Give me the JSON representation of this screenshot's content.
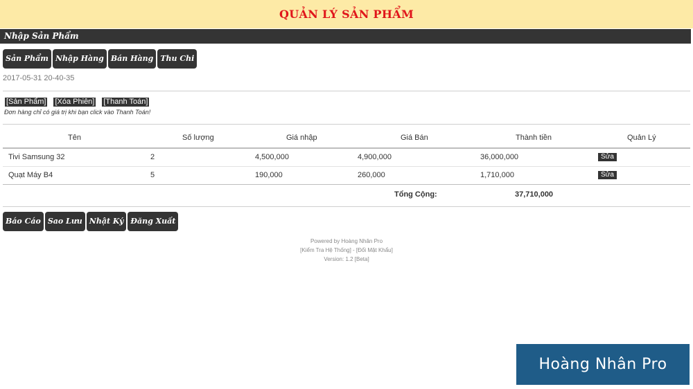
{
  "header": {
    "title": "QUẢN LÝ SẢN PHẨM"
  },
  "section": {
    "title": "Nhập Sản Phẩm"
  },
  "nav_top": [
    "Sản Phẩm",
    "Nhập Hàng",
    "Bán Hàng",
    "Thu Chi"
  ],
  "timestamp": "2017-05-31 20-40-35",
  "session_links": [
    "[Sản Phẩm]",
    "[Xóa Phiên]",
    "[Thanh Toán]"
  ],
  "note": "Đơn hàng chỉ có giá trị khi bạn click vào Thanh Toán!",
  "table": {
    "columns": [
      "Tên",
      "Số lượng",
      "Giá nhập",
      "Giá Bán",
      "Thành tiền",
      "Quản Lý"
    ],
    "rows": [
      {
        "name": "Tivi Samsung 32",
        "qty": "2",
        "cost": "4,500,000",
        "price": "4,900,000",
        "total": "36,000,000",
        "action": "Sửa"
      },
      {
        "name": "Quạt Máy B4",
        "qty": "5",
        "cost": "190,000",
        "price": "260,000",
        "total": "1,710,000",
        "action": "Sửa"
      }
    ],
    "total_label": "Tổng Cộng:",
    "total_value": "37,710,000"
  },
  "nav_bottom": [
    "Báo Cáo",
    "Sao Lưu",
    "Nhật Ký",
    "Đăng Xuất"
  ],
  "footer": {
    "powered": "Powered by Hoàng Nhân Pro",
    "links": "[Kiểm Tra Hệ Thống] - [Đổi Mật Khẩu]",
    "version": "Version: 1.2 [Beta]"
  },
  "watermark": "Hoàng Nhân Pro"
}
